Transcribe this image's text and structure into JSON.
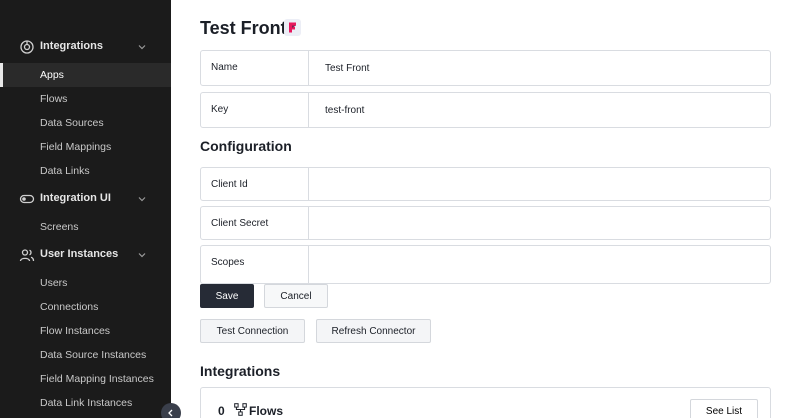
{
  "sidebar": {
    "groups": [
      {
        "label": "Integrations",
        "icon": "integrations-icon",
        "items": [
          "Apps",
          "Flows",
          "Data Sources",
          "Field Mappings",
          "Data Links"
        ]
      },
      {
        "label": "Integration UI",
        "icon": "toggle-icon",
        "items": [
          "Screens"
        ]
      },
      {
        "label": "User Instances",
        "icon": "users-icon",
        "items": [
          "Users",
          "Connections",
          "Flow Instances",
          "Data Source Instances",
          "Field Mapping Instances",
          "Data Link Instances"
        ]
      }
    ],
    "active_item": "Apps"
  },
  "page": {
    "title": "Test Front",
    "logo_letter": "F",
    "logo_color": "#e8175d"
  },
  "fields": [
    {
      "label": "Name",
      "value": "Test Front"
    },
    {
      "label": "Key",
      "value": "test-front"
    }
  ],
  "configuration": {
    "title": "Configuration",
    "fields": [
      {
        "label": "Client Id",
        "value": ""
      },
      {
        "label": "Client Secret",
        "value": ""
      },
      {
        "label": "Scopes",
        "value": ""
      }
    ]
  },
  "actions": {
    "save": "Save",
    "cancel": "Cancel",
    "test_connection": "Test Connection",
    "refresh_connector": "Refresh Connector"
  },
  "integrations": {
    "title": "Integrations",
    "flows_count": "0",
    "flows_label": "Flows",
    "see_list": "See List"
  },
  "colors": {
    "sidebar_bg": "#1b1b1b",
    "primary_button": "#262b36"
  }
}
